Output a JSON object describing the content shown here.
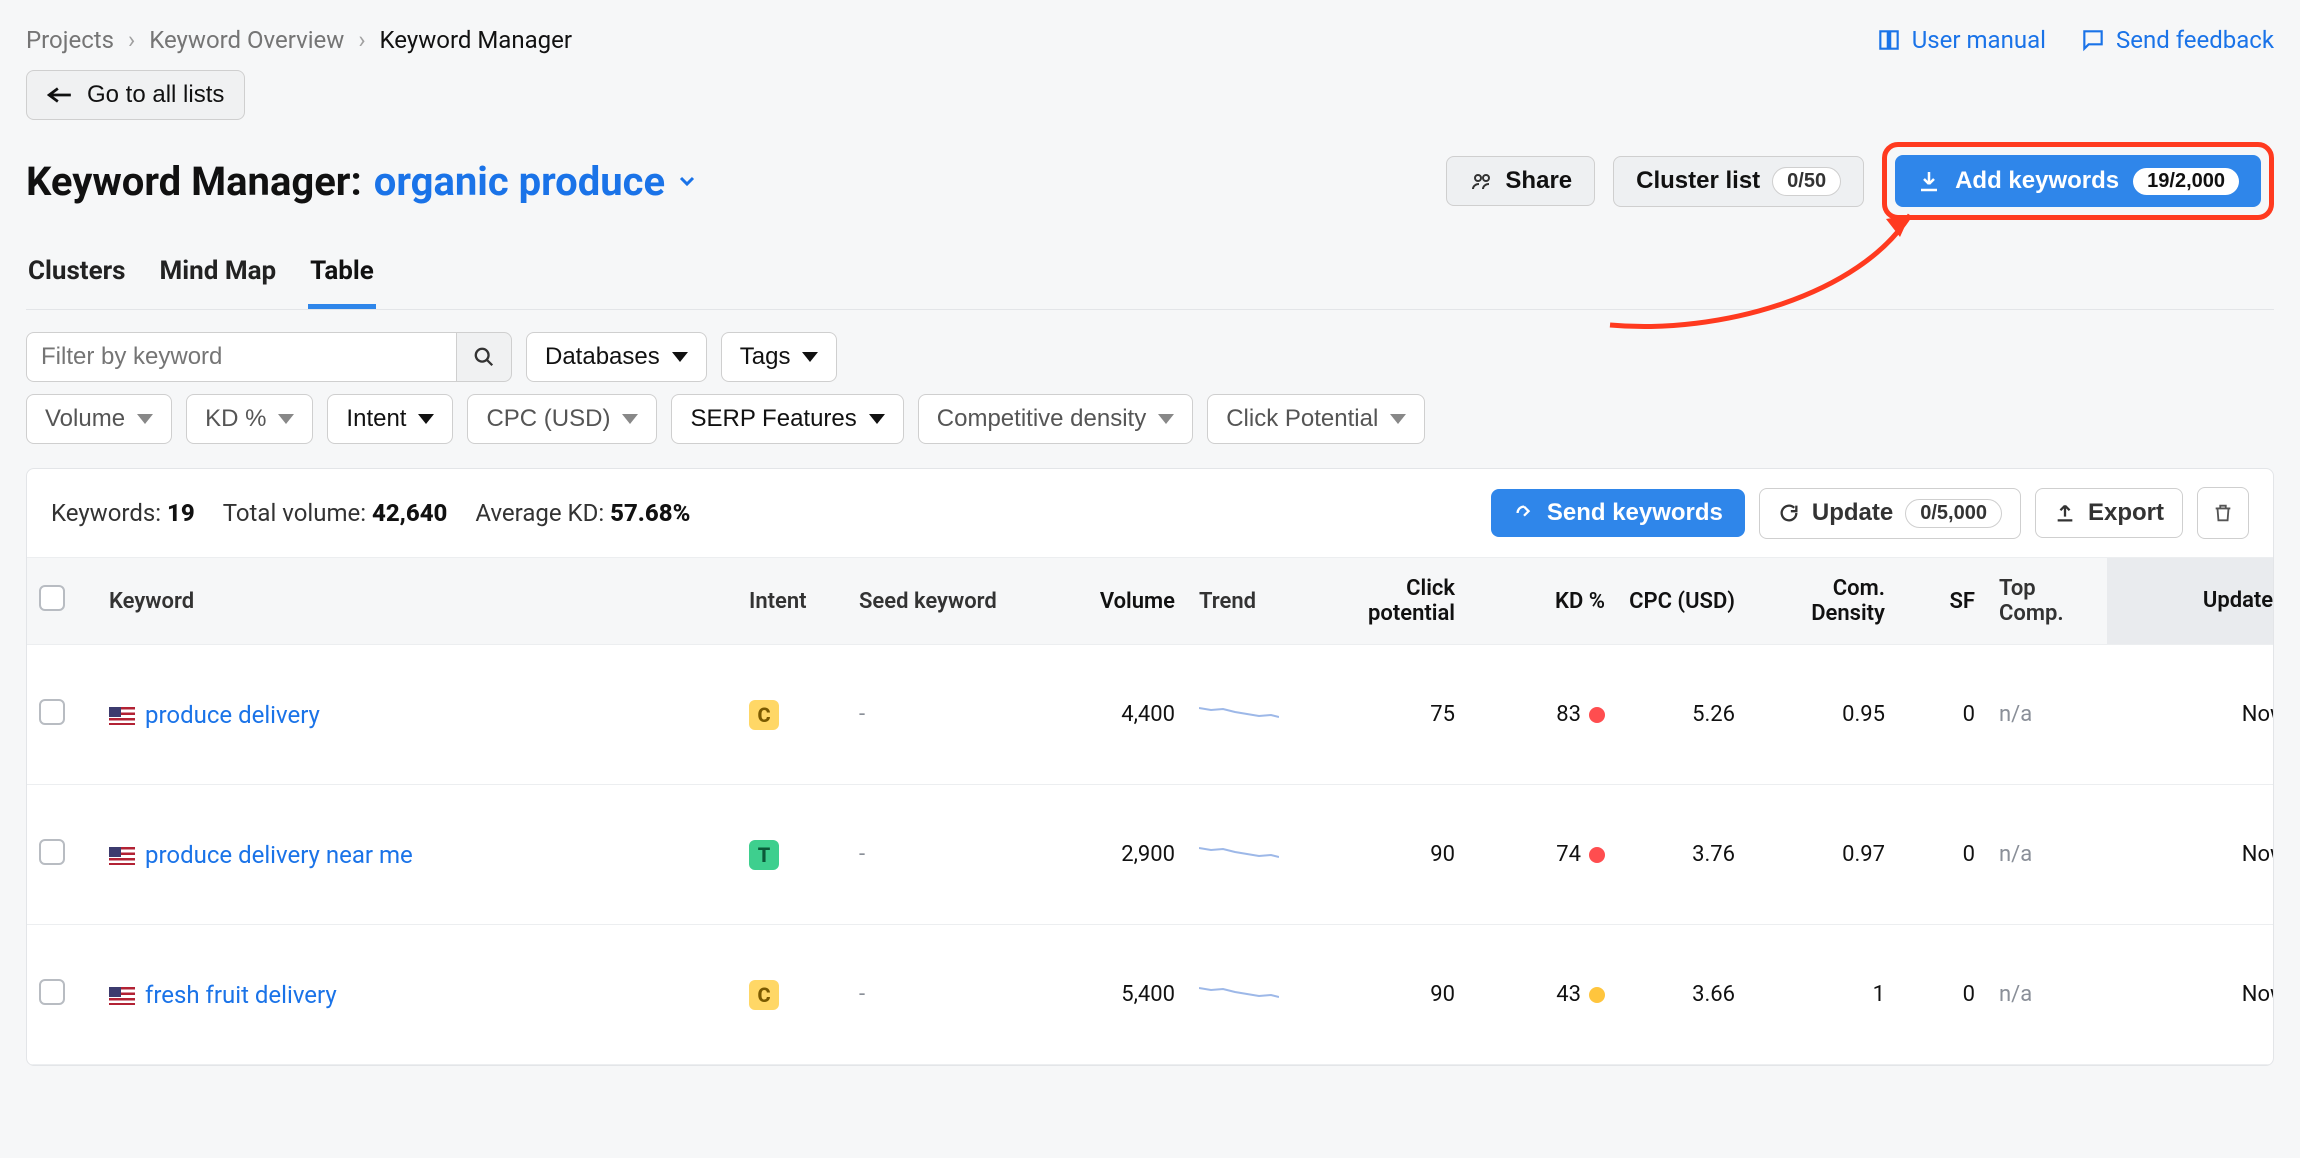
{
  "breadcrumbs": {
    "items": [
      "Projects",
      "Keyword Overview",
      "Keyword Manager"
    ]
  },
  "top_links": {
    "manual": "User manual",
    "feedback": "Send feedback"
  },
  "back_button": "Go to all lists",
  "title": {
    "prefix": "Keyword Manager:",
    "project": "organic produce"
  },
  "title_actions": {
    "share": "Share",
    "cluster_list": {
      "label": "Cluster list",
      "badge": "0/50"
    },
    "add_keywords": {
      "label": "Add keywords",
      "badge": "19/2,000"
    }
  },
  "tabs": [
    "Clusters",
    "Mind Map",
    "Table"
  ],
  "active_tab": "Table",
  "filters": {
    "search_placeholder": "Filter by keyword",
    "databases": "Databases",
    "tags": "Tags",
    "volume": "Volume",
    "kd": "KD %",
    "intent": "Intent",
    "cpc": "CPC (USD)",
    "serp": "SERP Features",
    "comp": "Competitive density",
    "click": "Click Potential"
  },
  "stats": {
    "keywords_label": "Keywords:",
    "keywords": "19",
    "volume_label": "Total volume:",
    "volume": "42,640",
    "kd_label": "Average KD:",
    "kd": "57.68%"
  },
  "card_actions": {
    "send": "Send keywords",
    "update": {
      "label": "Update",
      "badge": "0/5,000"
    },
    "export": "Export"
  },
  "columns": {
    "keyword": "Keyword",
    "intent": "Intent",
    "seed": "Seed keyword",
    "volume": "Volume",
    "trend": "Trend",
    "click": "Click potential",
    "kd": "KD %",
    "cpc": "CPC (USD)",
    "com": "Com. Density",
    "sf": "SF",
    "top": "Top Comp.",
    "updated": "Updated"
  },
  "rows": [
    {
      "keyword": "produce delivery",
      "intent": "C",
      "seed": "-",
      "volume": "4,400",
      "click": "75",
      "kd": "83",
      "kd_color": "red",
      "cpc": "5.26",
      "com": "0.95",
      "sf": "0",
      "top": "n/a",
      "updated": "Now"
    },
    {
      "keyword": "produce delivery near me",
      "intent": "T",
      "seed": "-",
      "volume": "2,900",
      "click": "90",
      "kd": "74",
      "kd_color": "red",
      "cpc": "3.76",
      "com": "0.97",
      "sf": "0",
      "top": "n/a",
      "updated": "Now"
    },
    {
      "keyword": "fresh fruit delivery",
      "intent": "C",
      "seed": "-",
      "volume": "5,400",
      "click": "90",
      "kd": "43",
      "kd_color": "yel",
      "cpc": "3.66",
      "com": "1",
      "sf": "0",
      "top": "n/a",
      "updated": "Now"
    }
  ]
}
